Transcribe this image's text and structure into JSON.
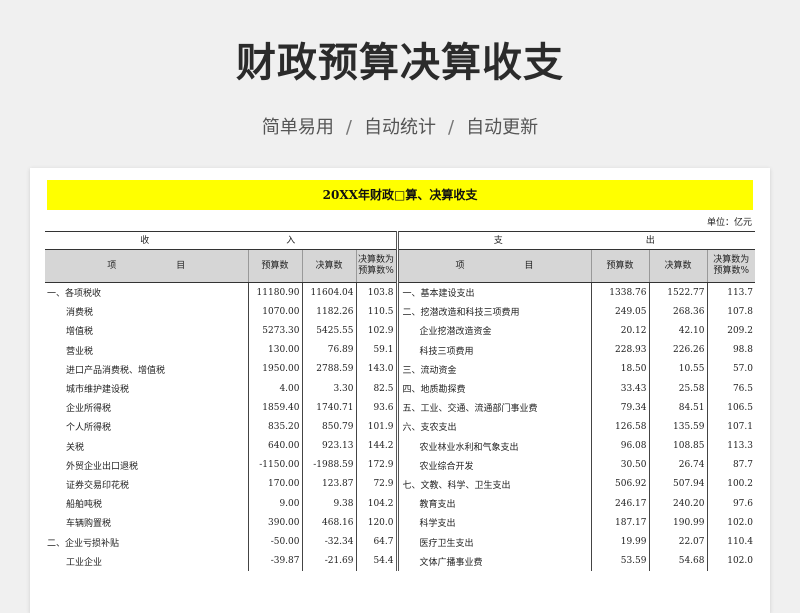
{
  "hero": {
    "title": "财政预算决算收支",
    "tags": [
      "简单易用",
      "自动统计",
      "自动更新"
    ],
    "separator": "/"
  },
  "sheet": {
    "banner_title": "20XX年财政□算、决算收支",
    "unit": "单位：亿元",
    "income_label_left": "收",
    "income_label_right": "入",
    "expense_label_left": "支",
    "expense_label_right": "出",
    "col_item_left": "项",
    "col_item_right": "目",
    "col_budget": "预算数",
    "col_final": "决算数",
    "col_pct_line1": "决算数为",
    "col_pct_line2": "预算数%",
    "rows": [
      {
        "in_name": "一、各项税收",
        "in_ind": false,
        "in_budget": "11180.90",
        "in_final": "11604.04",
        "in_pct": "103.8",
        "ex_name": "一、基本建设支出",
        "ex_ind": false,
        "ex_budget": "1338.76",
        "ex_final": "1522.77",
        "ex_pct": "113.7"
      },
      {
        "in_name": "消费税",
        "in_ind": true,
        "in_budget": "1070.00",
        "in_final": "1182.26",
        "in_pct": "110.5",
        "ex_name": "二、挖潜改造和科技三项费用",
        "ex_ind": false,
        "ex_budget": "249.05",
        "ex_final": "268.36",
        "ex_pct": "107.8"
      },
      {
        "in_name": "增值税",
        "in_ind": true,
        "in_budget": "5273.30",
        "in_final": "5425.55",
        "in_pct": "102.9",
        "ex_name": "企业挖潜改造资金",
        "ex_ind": true,
        "ex_budget": "20.12",
        "ex_final": "42.10",
        "ex_pct": "209.2"
      },
      {
        "in_name": "营业税",
        "in_ind": true,
        "in_budget": "130.00",
        "in_final": "76.89",
        "in_pct": "59.1",
        "ex_name": "科技三项费用",
        "ex_ind": true,
        "ex_budget": "228.93",
        "ex_final": "226.26",
        "ex_pct": "98.8"
      },
      {
        "in_name": "进口产品消费税、增值税",
        "in_ind": true,
        "in_budget": "1950.00",
        "in_final": "2788.59",
        "in_pct": "143.0",
        "ex_name": "三、流动资金",
        "ex_ind": false,
        "ex_budget": "18.50",
        "ex_final": "10.55",
        "ex_pct": "57.0"
      },
      {
        "in_name": "城市维护建设税",
        "in_ind": true,
        "in_budget": "4.00",
        "in_final": "3.30",
        "in_pct": "82.5",
        "ex_name": "四、地质勘探费",
        "ex_ind": false,
        "ex_budget": "33.43",
        "ex_final": "25.58",
        "ex_pct": "76.5"
      },
      {
        "in_name": "企业所得税",
        "in_ind": true,
        "in_budget": "1859.40",
        "in_final": "1740.71",
        "in_pct": "93.6",
        "ex_name": "五、工业、交通、流通部门事业费",
        "ex_ind": false,
        "ex_budget": "79.34",
        "ex_final": "84.51",
        "ex_pct": "106.5"
      },
      {
        "in_name": "个人所得税",
        "in_ind": true,
        "in_budget": "835.20",
        "in_final": "850.79",
        "in_pct": "101.9",
        "ex_name": "六、支农支出",
        "ex_ind": false,
        "ex_budget": "126.58",
        "ex_final": "135.59",
        "ex_pct": "107.1"
      },
      {
        "in_name": "关税",
        "in_ind": true,
        "in_budget": "640.00",
        "in_final": "923.13",
        "in_pct": "144.2",
        "ex_name": "农业林业水利和气象支出",
        "ex_ind": true,
        "ex_budget": "96.08",
        "ex_final": "108.85",
        "ex_pct": "113.3"
      },
      {
        "in_name": "外贸企业出口退税",
        "in_ind": true,
        "in_budget": "-1150.00",
        "in_final": "-1988.59",
        "in_pct": "172.9",
        "ex_name": "农业综合开发",
        "ex_ind": true,
        "ex_budget": "30.50",
        "ex_final": "26.74",
        "ex_pct": "87.7"
      },
      {
        "in_name": "证券交易印花税",
        "in_ind": true,
        "in_budget": "170.00",
        "in_final": "123.87",
        "in_pct": "72.9",
        "ex_name": "七、文教、科学、卫生支出",
        "ex_ind": false,
        "ex_budget": "506.92",
        "ex_final": "507.94",
        "ex_pct": "100.2"
      },
      {
        "in_name": "船舶吨税",
        "in_ind": true,
        "in_budget": "9.00",
        "in_final": "9.38",
        "in_pct": "104.2",
        "ex_name": "教育支出",
        "ex_ind": true,
        "ex_budget": "246.17",
        "ex_final": "240.20",
        "ex_pct": "97.6"
      },
      {
        "in_name": "车辆购置税",
        "in_ind": true,
        "in_budget": "390.00",
        "in_final": "468.16",
        "in_pct": "120.0",
        "ex_name": "科学支出",
        "ex_ind": true,
        "ex_budget": "187.17",
        "ex_final": "190.99",
        "ex_pct": "102.0"
      },
      {
        "in_name": "二、企业亏损补贴",
        "in_ind": false,
        "in_budget": "-50.00",
        "in_final": "-32.34",
        "in_pct": "64.7",
        "ex_name": "医疗卫生支出",
        "ex_ind": true,
        "ex_budget": "19.99",
        "ex_final": "22.07",
        "ex_pct": "110.4"
      },
      {
        "in_name": "工业企业",
        "in_ind": true,
        "in_budget": "-39.87",
        "in_final": "-21.69",
        "in_pct": "54.4",
        "ex_name": "文体广播事业费",
        "ex_ind": true,
        "ex_budget": "53.59",
        "ex_final": "54.68",
        "ex_pct": "102.0"
      }
    ]
  }
}
